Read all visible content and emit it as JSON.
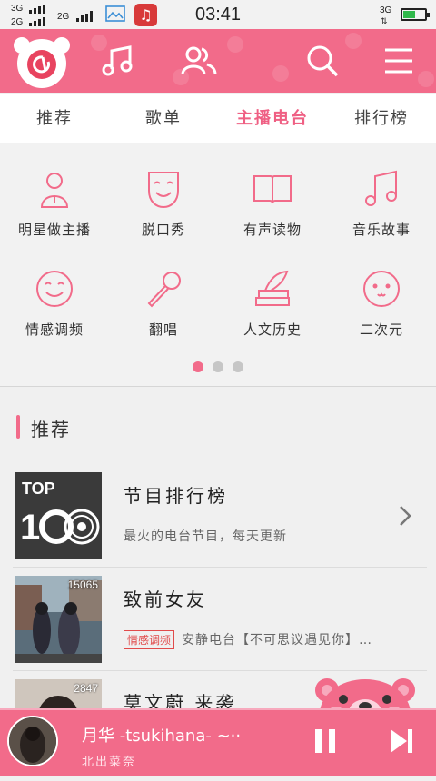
{
  "status_bar": {
    "sim1": "3G",
    "sim2": "2G",
    "sim3": "2G",
    "time": "03:41",
    "right_net": "3G",
    "battery_level": 0.55
  },
  "tabs": [
    {
      "label": "推荐",
      "active": false
    },
    {
      "label": "歌单",
      "active": false
    },
    {
      "label": "主播电台",
      "active": true
    },
    {
      "label": "排行榜",
      "active": false
    }
  ],
  "categories": [
    {
      "label": "明星做主播",
      "icon": "person-mic-icon"
    },
    {
      "label": "脱口秀",
      "icon": "mask-icon"
    },
    {
      "label": "有声读物",
      "icon": "book-icon"
    },
    {
      "label": "音乐故事",
      "icon": "music-note-icon"
    },
    {
      "label": "情感调频",
      "icon": "smiley-icon"
    },
    {
      "label": "翻唱",
      "icon": "microphone-icon"
    },
    {
      "label": "人文历史",
      "icon": "books-icon"
    },
    {
      "label": "二次元",
      "icon": "anime-face-icon"
    }
  ],
  "pager": {
    "count": 3,
    "active_index": 0
  },
  "section": {
    "title": "推荐"
  },
  "items": [
    {
      "title": "节目排行榜",
      "subtitle": "最火的电台节目，每天更新",
      "thumb_text_top": "TOP",
      "thumb_text_num": "100",
      "has_chevron": true
    },
    {
      "title": "致前女友",
      "badge": "15065",
      "tag": "情感调频",
      "subtitle": "安静电台【不可思议遇见你】…"
    },
    {
      "title": "莫文蔚 来袭",
      "badge": "2847"
    }
  ],
  "player": {
    "song": "月华 -tsukihana- ~··",
    "artist": "北出菜奈"
  },
  "colors": {
    "accent": "#f26b8a",
    "tag_red": "#e14b4b"
  }
}
